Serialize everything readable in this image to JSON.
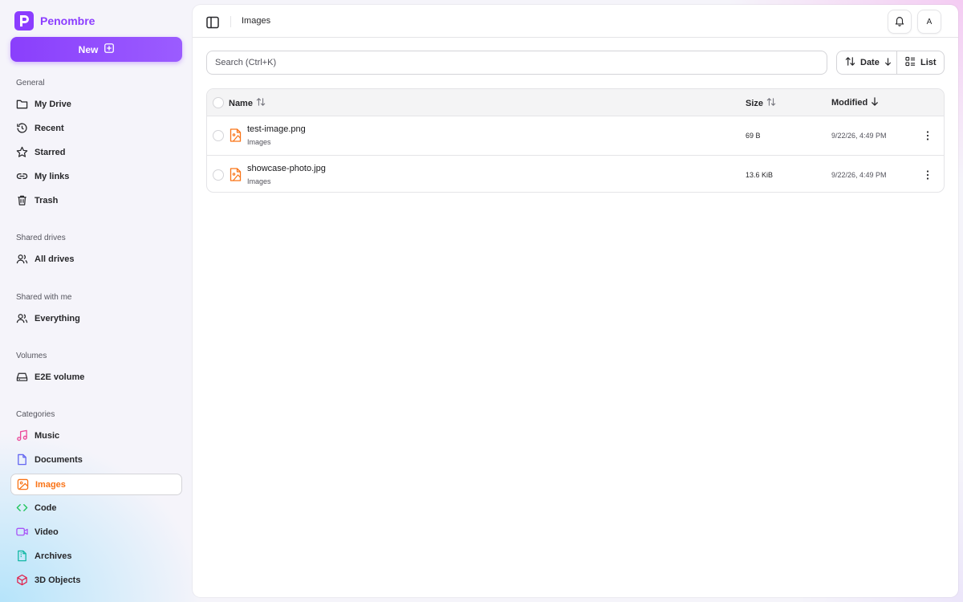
{
  "app": {
    "name": "Penombre",
    "accent": "#8b3dff"
  },
  "sidebar": {
    "new_label": "New",
    "sections": {
      "general": "General",
      "shared_drives": "Shared drives",
      "shared_with_me": "Shared with me",
      "volumes": "Volumes",
      "categories": "Categories"
    },
    "general_items": [
      {
        "label": "My Drive",
        "icon": "folder-icon"
      },
      {
        "label": "Recent",
        "icon": "history-icon"
      },
      {
        "label": "Starred",
        "icon": "star-icon"
      },
      {
        "label": "My links",
        "icon": "link-icon"
      },
      {
        "label": "Trash",
        "icon": "trash-icon"
      }
    ],
    "shared_drives_items": [
      {
        "label": "All drives",
        "icon": "users-icon"
      }
    ],
    "shared_with_me_items": [
      {
        "label": "Everything",
        "icon": "users-icon"
      }
    ],
    "volume_items": [
      {
        "label": "E2E volume",
        "icon": "hard-drive-icon"
      }
    ],
    "category_items": [
      {
        "label": "Music",
        "icon": "music-icon",
        "color": "#ec4899"
      },
      {
        "label": "Documents",
        "icon": "document-icon",
        "color": "#6366f1"
      },
      {
        "label": "Images",
        "icon": "image-icon",
        "color": "#f97316",
        "active": true
      },
      {
        "label": "Code",
        "icon": "code-icon",
        "color": "#22c55e"
      },
      {
        "label": "Video",
        "icon": "video-icon",
        "color": "#a855f7"
      },
      {
        "label": "Archives",
        "icon": "archive-icon",
        "color": "#14b8a6"
      },
      {
        "label": "3D Objects",
        "icon": "cube-icon",
        "color": "#e11d48"
      }
    ]
  },
  "header": {
    "breadcrumb": "Images",
    "avatar_initial": "A"
  },
  "toolbar": {
    "search_placeholder": "Search (Ctrl+K)",
    "sort_label": "Date",
    "view_label": "List"
  },
  "table": {
    "columns": {
      "name": "Name",
      "size": "Size",
      "modified": "Modified"
    },
    "rows": [
      {
        "name": "test-image.png",
        "category": "Images",
        "size": "69 B",
        "modified": "9/22/26, 4:49 PM"
      },
      {
        "name": "showcase-photo.jpg",
        "category": "Images",
        "size": "13.6 KiB",
        "modified": "9/22/26, 4:49 PM"
      }
    ]
  }
}
